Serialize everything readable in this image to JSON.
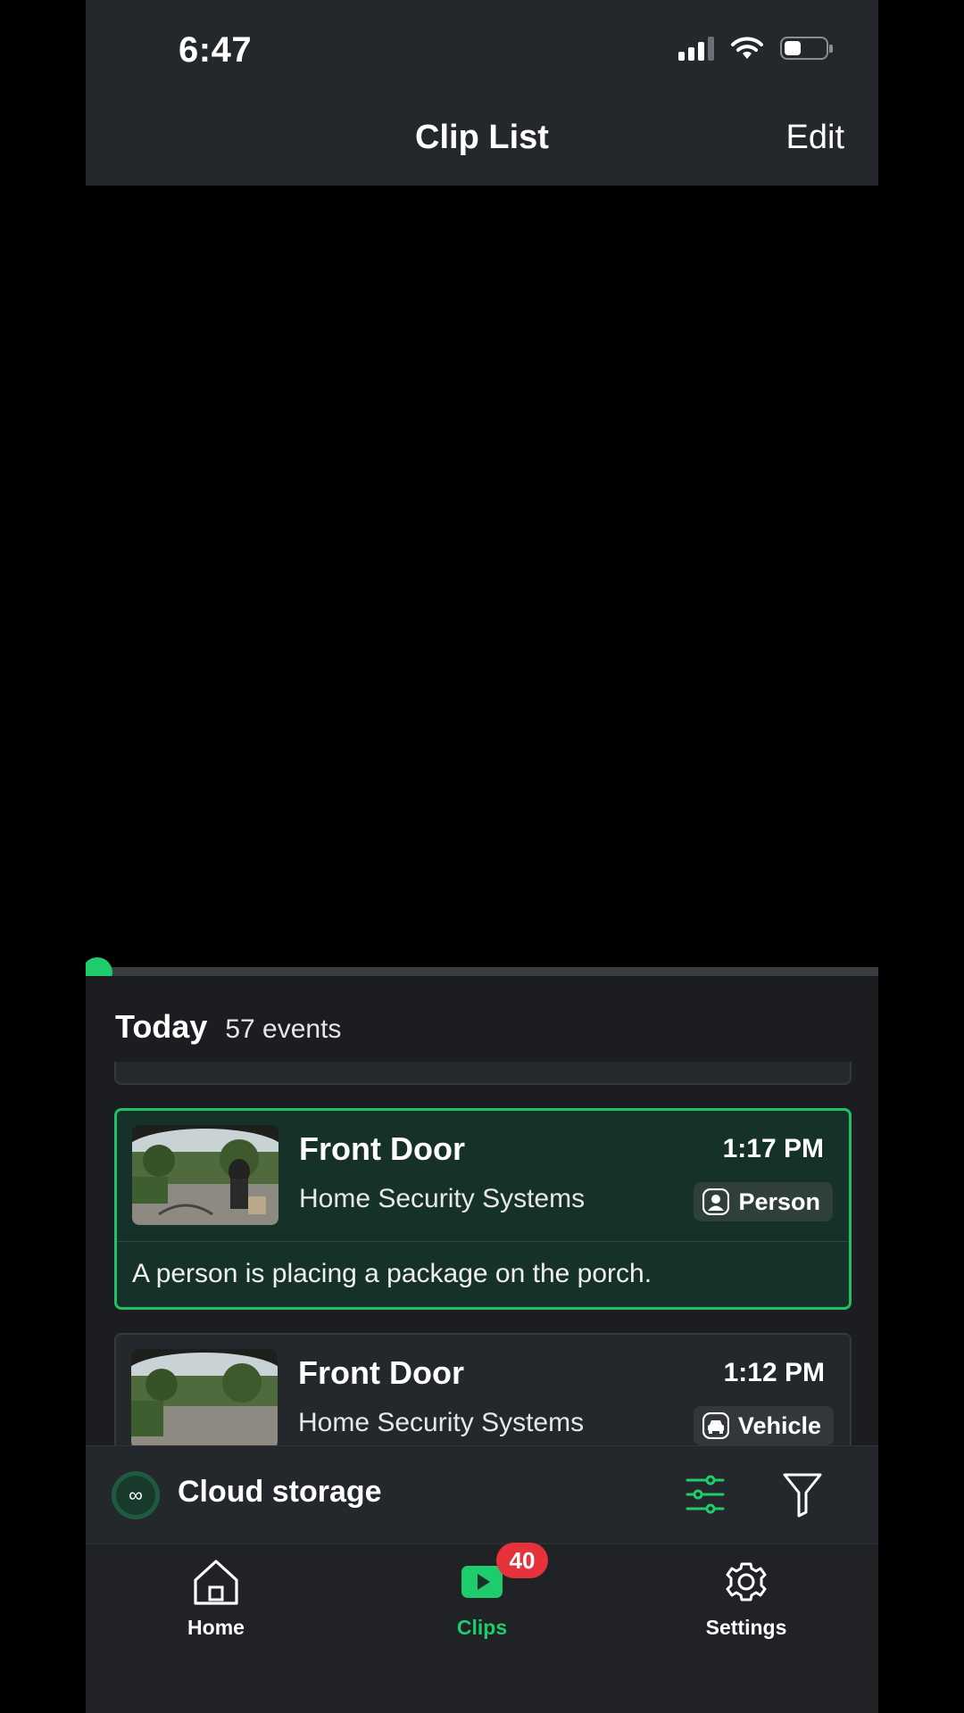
{
  "status_bar": {
    "time": "6:47"
  },
  "header": {
    "title": "Clip List",
    "edit_label": "Edit"
  },
  "clips_section": {
    "day_label": "Today",
    "event_count": "57 events"
  },
  "clips": [
    {
      "camera": "Front Door",
      "location": "Home Security Systems",
      "time": "1:17 PM",
      "tag": "Person",
      "tag_icon": "person-icon",
      "description": "A person is placing a package on the porch.",
      "selected": true
    },
    {
      "camera": "Front Door",
      "location": "Home Security Systems",
      "time": "1:12 PM",
      "tag": "Vehicle",
      "tag_icon": "vehicle-icon",
      "selected": false
    }
  ],
  "storage_bar": {
    "label": "Cloud storage",
    "icon_glyph": "∞"
  },
  "tabbar": {
    "home_label": "Home",
    "clips_label": "Clips",
    "clips_badge": "40",
    "settings_label": "Settings"
  },
  "colors": {
    "accent": "#1fcc6b",
    "badge": "#e5323b",
    "selected_card_bg": "#16312a",
    "panel_bg": "#1b1d20"
  }
}
